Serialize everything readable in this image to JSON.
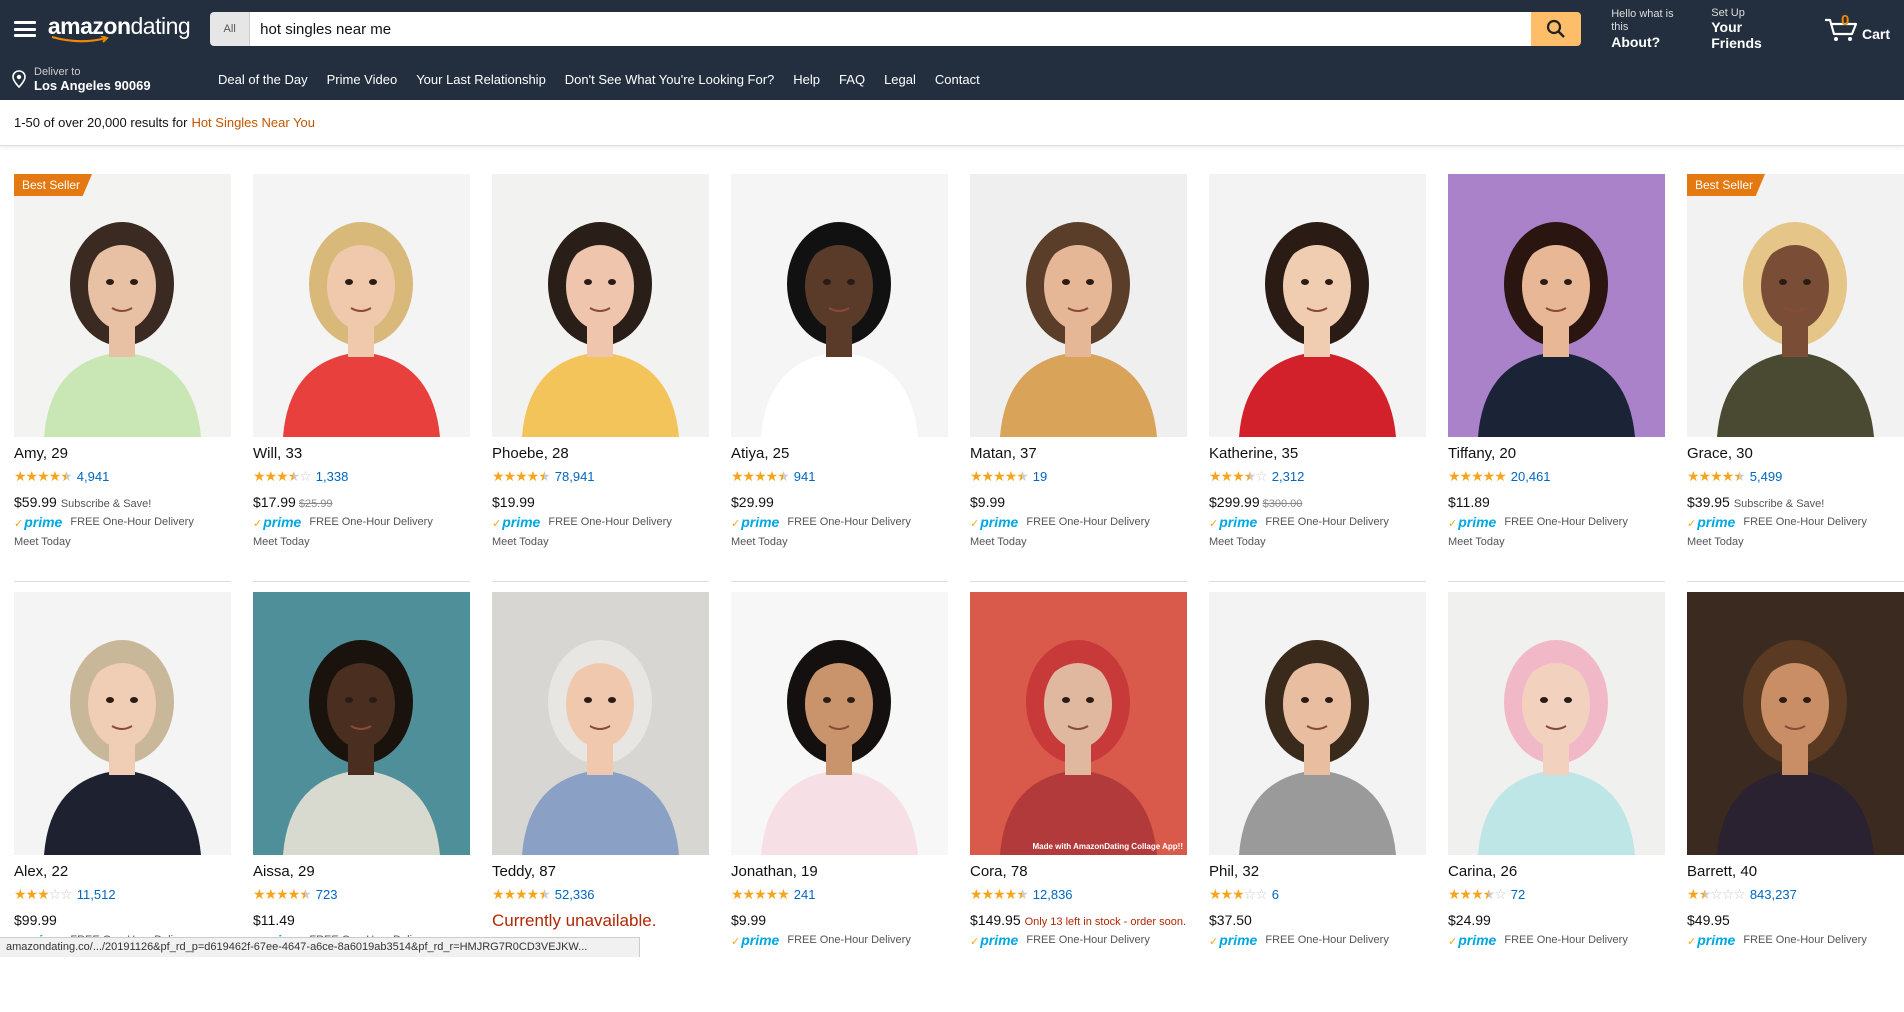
{
  "header": {
    "logo_bold": "amazon",
    "logo_rest": "dating",
    "search_category": "All",
    "search_value": "hot singles near me",
    "account": {
      "line1": "Hello what is this",
      "line2": "About?"
    },
    "friends": {
      "line1": "Set Up",
      "line2": "Your Friends"
    },
    "cart": {
      "count": "0",
      "label": "Cart"
    }
  },
  "subnav": {
    "deliver_line1": "Deliver to",
    "deliver_line2": "Los Angeles 90069",
    "links": [
      "Deal of the Day",
      "Prime Video",
      "Your Last Relationship",
      "Don't See What You're Looking For?",
      "Help",
      "FAQ",
      "Legal",
      "Contact"
    ]
  },
  "results": {
    "summary": "1-50 of over 20,000 results for",
    "query": "Hot Singles Near You"
  },
  "common": {
    "prime_label": "prime",
    "free_delivery": "FREE One-Hour Delivery",
    "meet_today": "Meet Today",
    "best_seller": "Best Seller",
    "subscribe": "Subscribe & Save!",
    "unavailable": "Currently unavailable.",
    "watermark": "Made with AmazonDating Collage App!!"
  },
  "products": [
    {
      "name": "Amy, 29",
      "rating": 4.5,
      "reviews": "4,941",
      "price": "$59.99",
      "subscribe": true,
      "best_seller": true,
      "bg": "#f3f3f1",
      "shirt": "#c9e6b5",
      "hair": "#3a2a22",
      "skin": "#e8c1a4"
    },
    {
      "name": "Will, 33",
      "rating": 3.5,
      "reviews": "1,338",
      "price": "$17.99",
      "old_price": "$25.99",
      "bg": "#f4f4f4",
      "shirt": "#e8413d",
      "hair": "#d8b97a",
      "skin": "#f0c8ac"
    },
    {
      "name": "Phoebe, 28",
      "rating": 4.5,
      "reviews": "78,941",
      "price": "$19.99",
      "bg": "#f2f2f0",
      "shirt": "#f2c45a",
      "hair": "#2a1e18",
      "skin": "#efc6ad"
    },
    {
      "name": "Atiya, 25",
      "rating": 4.5,
      "reviews": "941",
      "price": "$29.99",
      "bg": "#f5f5f5",
      "shirt": "#ffffff",
      "hair": "#111111",
      "skin": "#5a3a28"
    },
    {
      "name": "Matan, 37",
      "rating": 4.5,
      "reviews": "19",
      "price": "$9.99",
      "bg": "#efefef",
      "shirt": "#d9a35a",
      "hair": "#5a3e2a",
      "skin": "#e6b796"
    },
    {
      "name": "Katherine, 35",
      "rating": 3.5,
      "reviews": "2,312",
      "price": "$299.99",
      "old_price": "$300.00",
      "bg": "#f3f3f3",
      "shirt": "#d2212a",
      "hair": "#2a1c15",
      "skin": "#f0cdb0"
    },
    {
      "name": "Tiffany, 20",
      "rating": 5,
      "reviews": "20,461",
      "price": "$11.89",
      "bg": "#a982c9",
      "shirt": "#1b2337",
      "hair": "#2a1510",
      "skin": "#e8b795"
    },
    {
      "name": "Grace, 30",
      "rating": 4.5,
      "reviews": "5,499",
      "price": "$39.95",
      "subscribe": true,
      "best_seller": true,
      "bg": "#f2f2f2",
      "shirt": "#4a4a32",
      "hair": "#e6c688",
      "skin": "#7a4e36"
    },
    {
      "name": "Alex, 22",
      "rating": 3,
      "reviews": "11,512",
      "price": "$99.99",
      "bg": "#f4f4f4",
      "shirt": "#1e2230",
      "hair": "#c9b79a",
      "skin": "#f0cdb5"
    },
    {
      "name": "Aissa, 29",
      "rating": 4.5,
      "reviews": "723",
      "price": "$11.49",
      "bg": "#4f8f9a",
      "shirt": "#d8d9cf",
      "hair": "#1a120c",
      "skin": "#4a2e20"
    },
    {
      "name": "Teddy, 87",
      "rating": 4.5,
      "reviews": "52,336",
      "unavailable": true,
      "bg": "#d8d6d2",
      "shirt": "#8aa0c4",
      "hair": "#e8e6e2",
      "skin": "#f0c8ae"
    },
    {
      "name": "Jonathan, 19",
      "rating": 5,
      "reviews": "241",
      "price": "$9.99",
      "bg": "#f7f7f7",
      "shirt": "#f6e0e6",
      "hair": "#151010",
      "skin": "#c9936c"
    },
    {
      "name": "Cora, 78",
      "rating": 4.5,
      "reviews": "12,836",
      "price": "$149.95",
      "stock": "Only 13 left in stock - order soon.",
      "watermark": true,
      "bg": "#d95a4a",
      "shirt": "#b23a3a",
      "hair": "#c83a3a",
      "skin": "#e0b8a0"
    },
    {
      "name": "Phil, 32",
      "rating": 3,
      "reviews": "6",
      "price": "$37.50",
      "bg": "#f3f3f3",
      "shirt": "#9a9a9a",
      "hair": "#3a2a1c",
      "skin": "#e8bda0"
    },
    {
      "name": "Carina, 26",
      "rating": 3.5,
      "reviews": "72",
      "price": "$24.99",
      "bg": "#f0f0ee",
      "shirt": "#bfe6e6",
      "hair": "#f1b8c8",
      "skin": "#f2d2bf"
    },
    {
      "name": "Barrett, 40",
      "rating": 1.5,
      "reviews": "843,237",
      "price": "$49.95",
      "bg": "#3a2a20",
      "shirt": "#2a2230",
      "hair": "#5a3a22",
      "skin": "#c98e66"
    }
  ],
  "status_url": "amazondating.co/.../20191126&pf_rd_p=d619462f-67ee-4647-a6ce-8a6019ab3514&pf_rd_r=HMJRG7R0CD3VEJKW..."
}
